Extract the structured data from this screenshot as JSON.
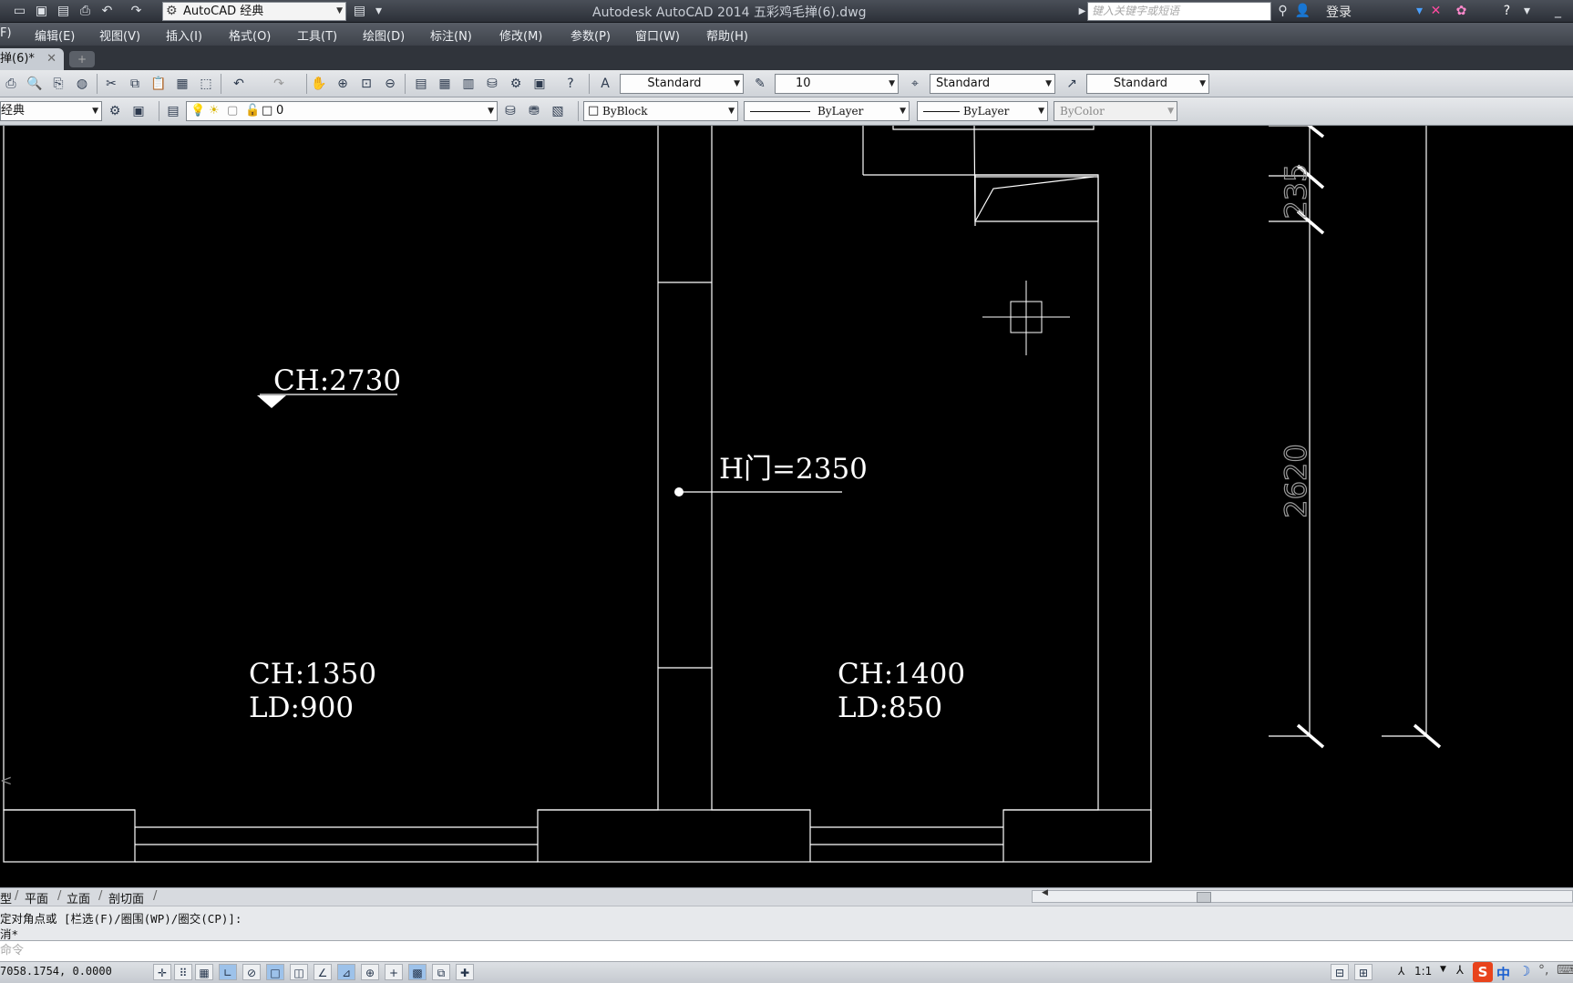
{
  "titlebar": {
    "workspace": "AutoCAD 经典",
    "title": "Autodesk AutoCAD 2014    五彩鸡毛掸(6).dwg",
    "search_placeholder": "键入关键字或短语",
    "login": "登录"
  },
  "menu": [
    "F)",
    "编辑(E)",
    "视图(V)",
    "插入(I)",
    "格式(O)",
    "工具(T)",
    "绘图(D)",
    "标注(N)",
    "修改(M)",
    "参数(P)",
    "窗口(W)",
    "帮助(H)"
  ],
  "doc_tab": "掸(6)*",
  "styles_toolbar": {
    "text_style": "Standard",
    "dim_scale": "10",
    "dim_style": "Standard",
    "multileader_style": "Standard"
  },
  "layers_toolbar": {
    "workspace_partial": "经典",
    "layer": "0",
    "color": "ByBlock",
    "linetype": "ByLayer",
    "lineweight": "ByLayer",
    "plotstyle": "ByColor"
  },
  "drawing": {
    "ch_room1": "CH:2730",
    "h_door": "H门=2350",
    "ch_room2": "CH:1350",
    "ld_room2": "LD:900",
    "ch_room3": "CH:1400",
    "ld_room3": "LD:850",
    "dim_small": "235",
    "dim_large": "2620"
  },
  "layout_tabs": [
    "型",
    "平面",
    "立面",
    "剖切面"
  ],
  "command": {
    "history_line1": "定对角点或 [栏选(F)/圈围(WP)/圈交(CP)]:",
    "history_line2": "消*",
    "prompt": "命令"
  },
  "status": {
    "coords": "7058.1754, 0.0000",
    "scale": "1:1",
    "ime": "中"
  },
  "colors": {
    "canvas": "#000000",
    "lines": "#ffffff",
    "dim_text": "#a0a0a0"
  }
}
